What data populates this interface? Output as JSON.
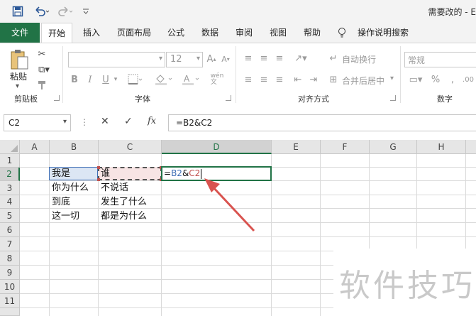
{
  "window": {
    "title": "需要改的 - E"
  },
  "tabs": [
    {
      "label": "文件"
    },
    {
      "label": "开始"
    },
    {
      "label": "插入"
    },
    {
      "label": "页面布局"
    },
    {
      "label": "公式"
    },
    {
      "label": "数据"
    },
    {
      "label": "审阅"
    },
    {
      "label": "视图"
    },
    {
      "label": "帮助"
    },
    {
      "label": "操作说明搜索"
    }
  ],
  "ribbon": {
    "clipboard": {
      "paste_label": "粘贴",
      "group_label": "剪贴板"
    },
    "font": {
      "font_name": "",
      "font_size": "12",
      "bold": "B",
      "italic": "I",
      "underline": "U",
      "group_label": "字体"
    },
    "alignment": {
      "wrap_text": "自动换行",
      "merge_center": "合并后居中",
      "group_label": "对齐方式"
    },
    "number": {
      "format": "常规",
      "group_label": "数字"
    }
  },
  "formula_bar": {
    "name_box": "C2",
    "fx": "fx",
    "formula": "=B2&C2"
  },
  "sheet": {
    "columns": [
      "A",
      "B",
      "C",
      "D",
      "E",
      "F",
      "G",
      "H"
    ],
    "rows": [
      "1",
      "2",
      "3",
      "4",
      "5",
      "6",
      "7",
      "8",
      "9",
      "10",
      "11"
    ],
    "cells": {
      "B2": "我是",
      "C2": "谁",
      "B3": "你为什么",
      "C3": "不说话",
      "B4": "到底",
      "C4": "发生了什么",
      "B5": "这一切",
      "C5": "都是为什么"
    },
    "editing_cell": {
      "prefix": "=",
      "ref1": "B2",
      "amp": "&",
      "ref2": "C2"
    },
    "colors": {
      "ref1": "#3f6fb5",
      "ref2": "#c0504d",
      "arrow": "#d9534f",
      "file_tab": "#217346"
    }
  },
  "watermark": {
    "text": "软件技巧"
  }
}
